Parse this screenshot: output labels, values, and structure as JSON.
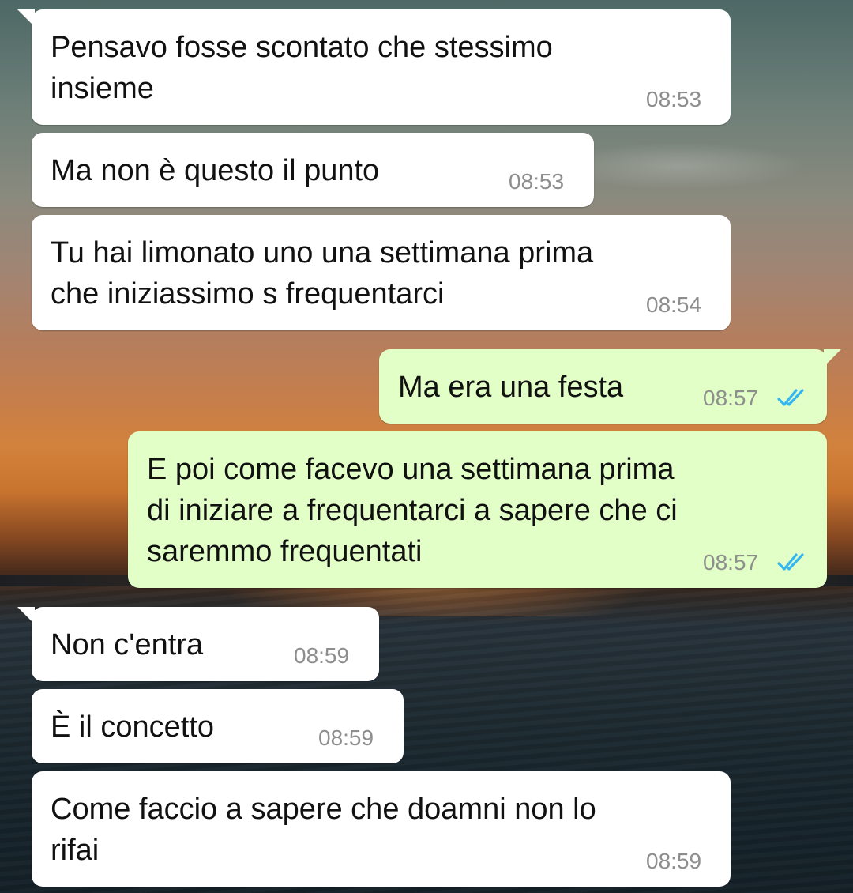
{
  "conversation": {
    "messages": [
      {
        "direction": "incoming",
        "text": "Pensavo fosse scontato che stessimo\ninsieme",
        "time": "08:53"
      },
      {
        "direction": "incoming",
        "text": "Ma non è questo il punto",
        "time": "08:53"
      },
      {
        "direction": "incoming",
        "text": "Tu hai limonato uno una settimana prima\nche iniziassimo s frequentarci",
        "time": "08:54"
      },
      {
        "direction": "outgoing",
        "text": "Ma era una festa",
        "time": "08:57",
        "status": "read"
      },
      {
        "direction": "outgoing",
        "text": "E poi come facevo una settimana prima\ndi iniziare a frequentarci a sapere che ci\nsaremmo frequentati",
        "time": "08:57",
        "status": "read"
      },
      {
        "direction": "incoming",
        "text": "Non c'entra",
        "time": "08:59"
      },
      {
        "direction": "incoming",
        "text": "È il concetto",
        "time": "08:59"
      },
      {
        "direction": "incoming",
        "text": "Come faccio a sapere che doamni non lo\nrifai",
        "time": "08:59"
      }
    ]
  },
  "colors": {
    "incoming_bubble": "#ffffff",
    "outgoing_bubble": "#e2ffc7",
    "timestamp": "#8e8e8e",
    "read_ticks": "#34b7f1"
  },
  "icons": {
    "read_receipt": "double-check-icon"
  }
}
